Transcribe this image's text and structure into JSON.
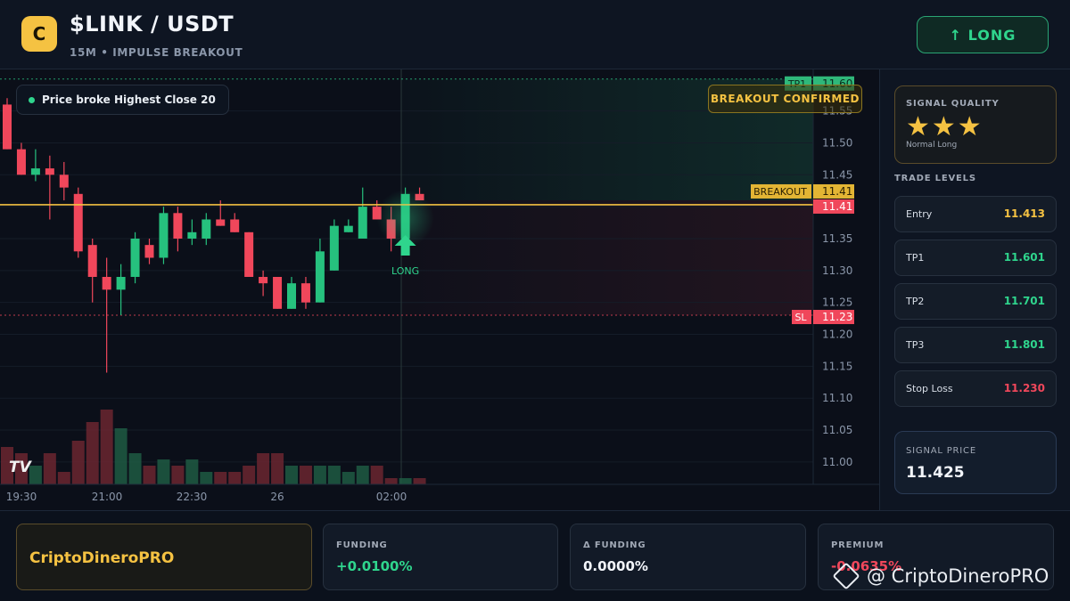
{
  "header": {
    "logo_letter": "C",
    "title": "$LINK / USDT",
    "subtitle": "15M • IMPULSE BREAKOUT",
    "long_button": "↑ LONG"
  },
  "chart": {
    "banner": "Price broke Highest Close 20",
    "confirmed_label": "BREAKOUT CONFIRMED",
    "long_marker": "LONG",
    "tv_logo": "TV",
    "price_axis": [
      "11.55",
      "11.50",
      "11.45",
      "11.40",
      "11.35",
      "11.30",
      "11.25",
      "11.20",
      "11.15",
      "11.10",
      "11.05",
      "11.00"
    ],
    "time_axis": [
      "19:30",
      "21:00",
      "22:30",
      "26",
      "02:00"
    ],
    "tags": {
      "tp1": {
        "label": "TP1",
        "value": "11.60"
      },
      "breakout": {
        "label": "BREAKOUT",
        "value": "11.41"
      },
      "current": {
        "value": "11.41"
      },
      "sl": {
        "label": "SL",
        "value": "11.23"
      }
    },
    "colors": {
      "up": "#26c17e",
      "down": "#f0475b",
      "breakout": "#f5c242",
      "tp": "#2fd58d"
    }
  },
  "chart_data": {
    "type": "candlestick",
    "ylim": [
      10.965,
      11.615
    ],
    "levels": {
      "tp1": 11.6,
      "breakout": 11.41,
      "sl": 11.23
    },
    "candles": [
      {
        "o": 11.56,
        "h": 11.57,
        "l": 11.49,
        "c": 11.49
      },
      {
        "o": 11.49,
        "h": 11.5,
        "l": 11.45,
        "c": 11.45
      },
      {
        "o": 11.45,
        "h": 11.49,
        "l": 11.44,
        "c": 11.46
      },
      {
        "o": 11.46,
        "h": 11.48,
        "l": 11.38,
        "c": 11.45
      },
      {
        "o": 11.45,
        "h": 11.47,
        "l": 11.41,
        "c": 11.43
      },
      {
        "o": 11.42,
        "h": 11.43,
        "l": 11.32,
        "c": 11.33
      },
      {
        "o": 11.34,
        "h": 11.35,
        "l": 11.25,
        "c": 11.29
      },
      {
        "o": 11.29,
        "h": 11.32,
        "l": 11.14,
        "c": 11.27
      },
      {
        "o": 11.27,
        "h": 11.31,
        "l": 11.23,
        "c": 11.29
      },
      {
        "o": 11.29,
        "h": 11.36,
        "l": 11.28,
        "c": 11.35
      },
      {
        "o": 11.34,
        "h": 11.35,
        "l": 11.31,
        "c": 11.32
      },
      {
        "o": 11.32,
        "h": 11.4,
        "l": 11.31,
        "c": 11.39
      },
      {
        "o": 11.39,
        "h": 11.4,
        "l": 11.33,
        "c": 11.35
      },
      {
        "o": 11.35,
        "h": 11.38,
        "l": 11.34,
        "c": 11.36
      },
      {
        "o": 11.35,
        "h": 11.39,
        "l": 11.34,
        "c": 11.38
      },
      {
        "o": 11.38,
        "h": 11.41,
        "l": 11.37,
        "c": 11.37
      },
      {
        "o": 11.38,
        "h": 11.39,
        "l": 11.36,
        "c": 11.36
      },
      {
        "o": 11.36,
        "h": 11.36,
        "l": 11.29,
        "c": 11.29
      },
      {
        "o": 11.29,
        "h": 11.3,
        "l": 11.26,
        "c": 11.28
      },
      {
        "o": 11.29,
        "h": 11.29,
        "l": 11.24,
        "c": 11.24
      },
      {
        "o": 11.24,
        "h": 11.29,
        "l": 11.24,
        "c": 11.28
      },
      {
        "o": 11.28,
        "h": 11.29,
        "l": 11.24,
        "c": 11.25
      },
      {
        "o": 11.25,
        "h": 11.35,
        "l": 11.25,
        "c": 11.33
      },
      {
        "o": 11.3,
        "h": 11.38,
        "l": 11.3,
        "c": 11.37
      },
      {
        "o": 11.36,
        "h": 11.38,
        "l": 11.36,
        "c": 11.37
      },
      {
        "o": 11.35,
        "h": 11.43,
        "l": 11.35,
        "c": 11.4
      },
      {
        "o": 11.4,
        "h": 11.41,
        "l": 11.38,
        "c": 11.38
      },
      {
        "o": 11.38,
        "h": 11.4,
        "l": 11.33,
        "c": 11.35
      },
      {
        "o": 11.35,
        "h": 11.43,
        "l": 11.35,
        "c": 11.42
      },
      {
        "o": 11.42,
        "h": 11.43,
        "l": 11.41,
        "c": 11.41
      }
    ],
    "volume": [
      6,
      5,
      3,
      5,
      2,
      7,
      10,
      12,
      9,
      5,
      3,
      4,
      3,
      4,
      2,
      2,
      2,
      3,
      5,
      5,
      3,
      3,
      3,
      3,
      2,
      3,
      3,
      1,
      1,
      1
    ],
    "x_labels": [
      "19:30",
      "21:00",
      "22:30",
      "26",
      "02:00"
    ]
  },
  "side": {
    "quality": {
      "label": "SIGNAL QUALITY",
      "stars": "★★★",
      "sub": "Normal Long"
    },
    "levels_header": "TRADE LEVELS",
    "levels": [
      {
        "name": "Entry",
        "value": "11.413",
        "color": "#f5c242"
      },
      {
        "name": "TP1",
        "value": "11.601",
        "color": "#2fd58d"
      },
      {
        "name": "TP2",
        "value": "11.701",
        "color": "#2fd58d"
      },
      {
        "name": "TP3",
        "value": "11.801",
        "color": "#2fd58d"
      },
      {
        "name": "Stop Loss",
        "value": "11.230",
        "color": "#f0475b"
      }
    ],
    "signal_price": {
      "label": "SIGNAL PRICE",
      "value": "11.425"
    }
  },
  "footer": {
    "brand": "CriptoDineroPRO",
    "funding": {
      "label": "FUNDING",
      "value": "+0.0100%",
      "color": "#2fd58d"
    },
    "delta_funding": {
      "label": "Δ FUNDING",
      "value": "0.0000%",
      "color": "#f2f5fa"
    },
    "premium": {
      "label": "PREMIUM",
      "value": "-0.0635%",
      "color": "#f0475b"
    },
    "watermark": "@ CriptoDineroPRO"
  }
}
